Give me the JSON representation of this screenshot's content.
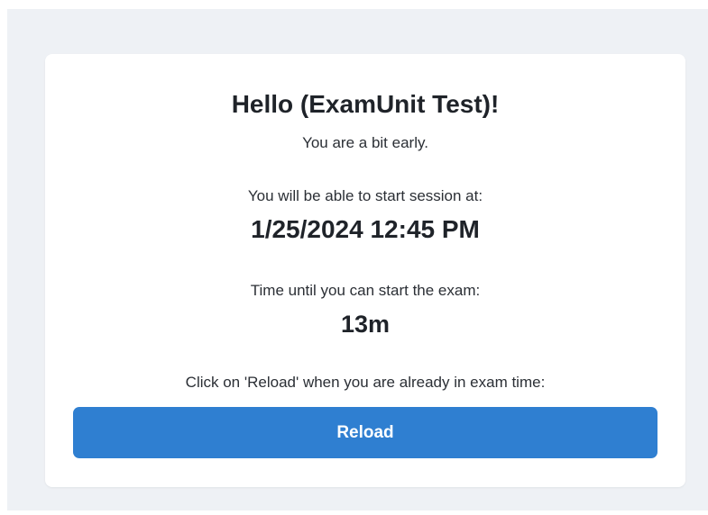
{
  "greeting": {
    "title": "Hello (ExamUnit Test)!",
    "subtitle": "You are a bit early."
  },
  "session": {
    "start_label": "You will be able to start session at:",
    "start_time": "1/25/2024 12:45 PM"
  },
  "countdown": {
    "label": "Time until you can start the exam:",
    "value": "13m"
  },
  "reload": {
    "instruction": "Click on 'Reload' when you are already in exam time:",
    "button_label": "Reload"
  },
  "colors": {
    "button": "#2f7fd1",
    "page_background": "#eef1f5",
    "card_background": "#ffffff"
  }
}
